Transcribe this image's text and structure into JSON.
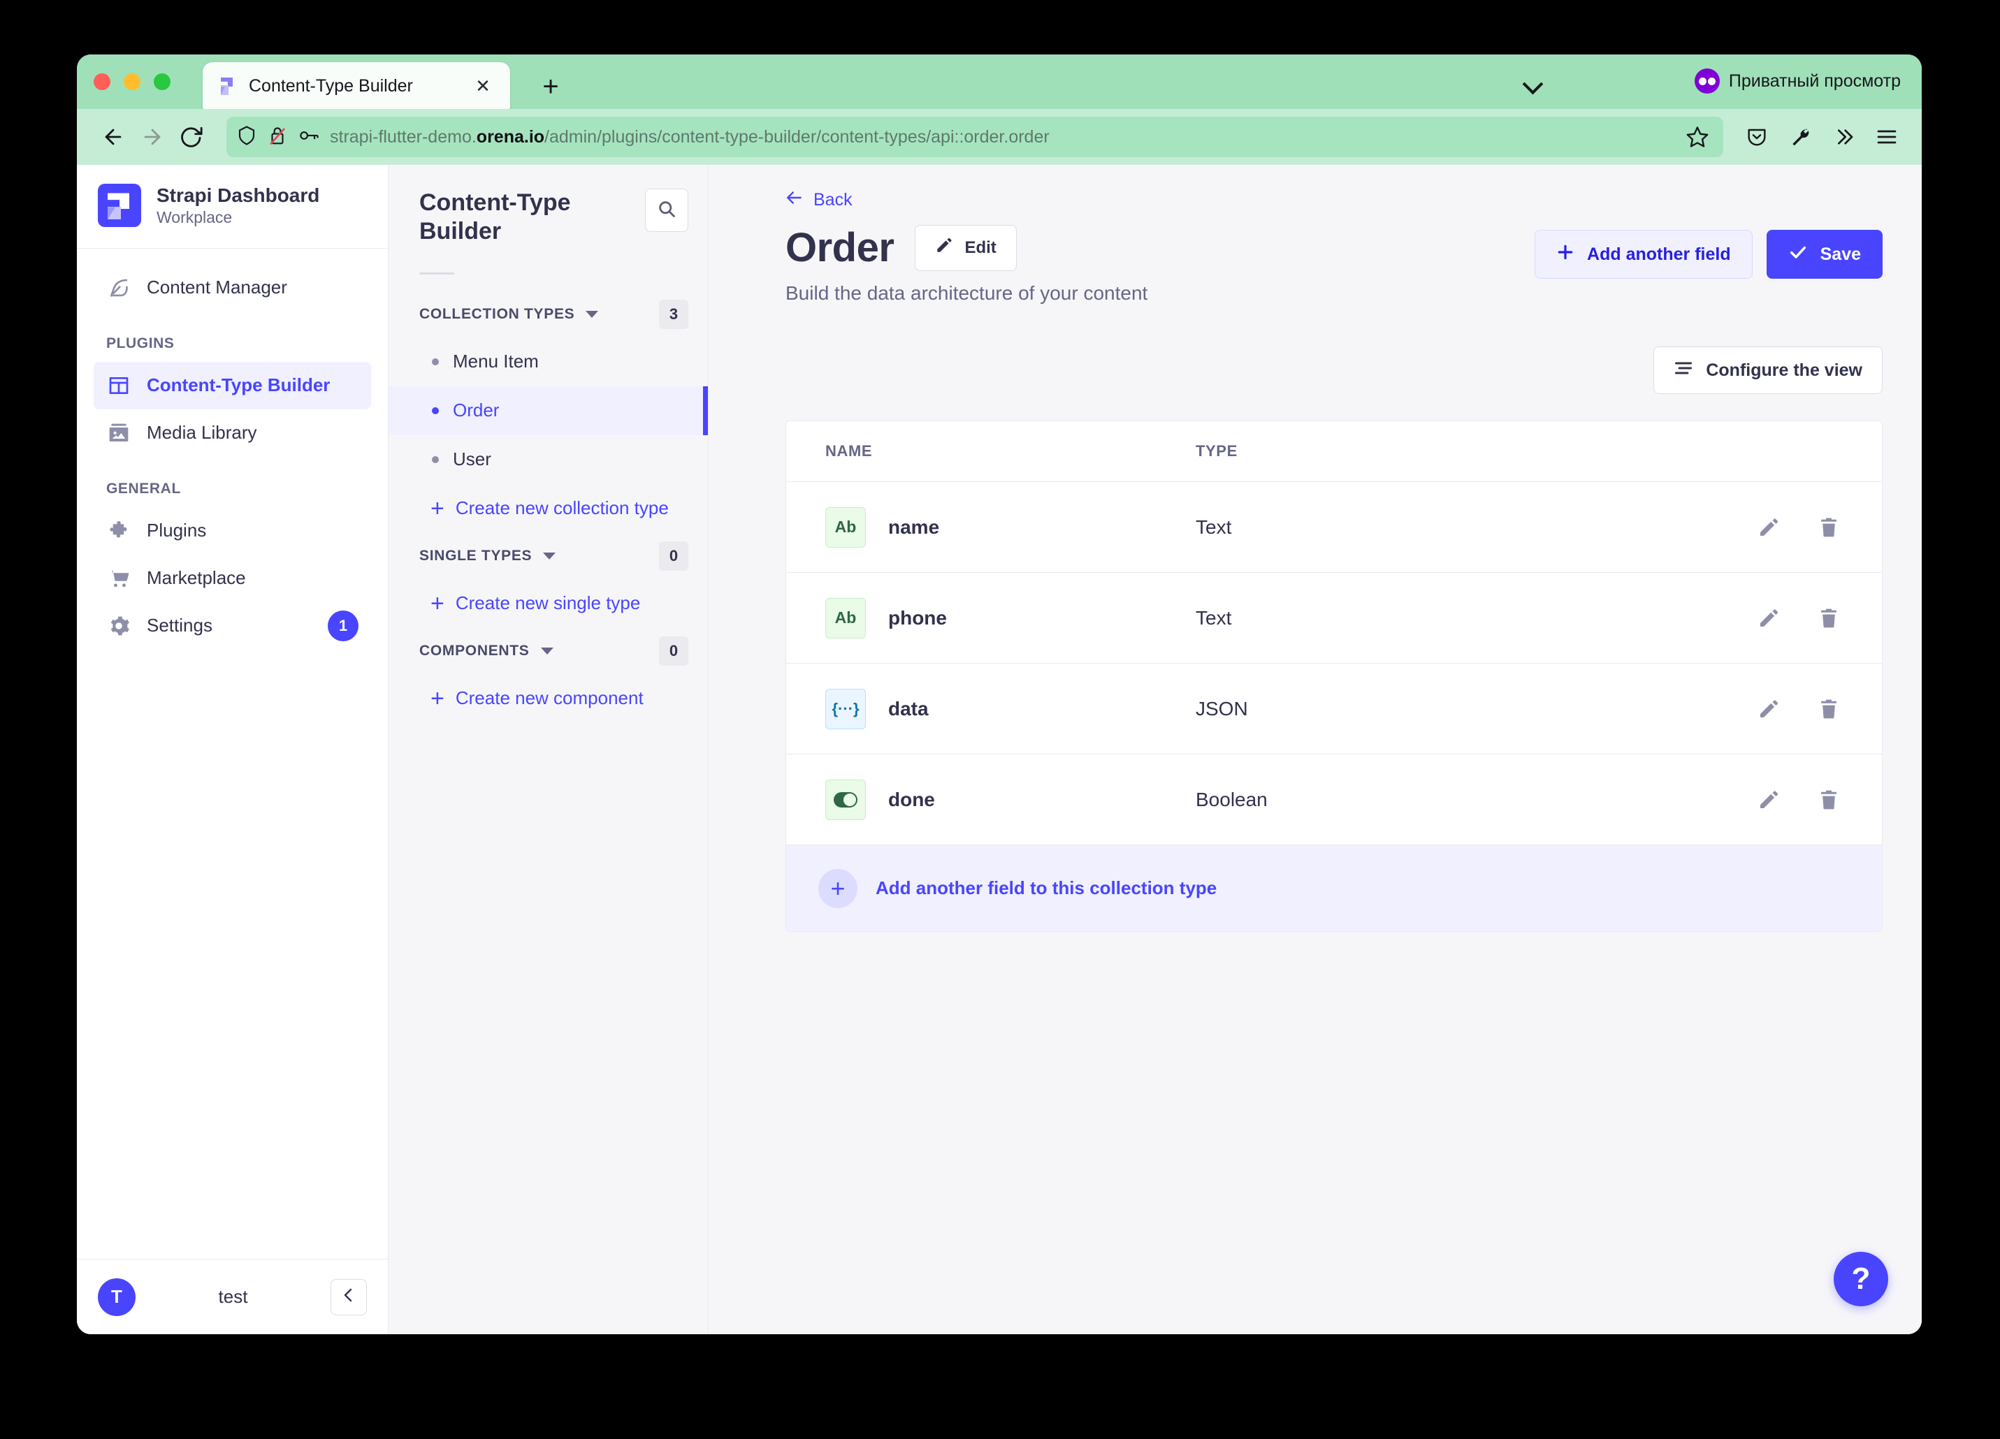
{
  "browser": {
    "tab": {
      "title": "Content-Type Builder",
      "favicon": "strapi-logo-icon",
      "close": "✕"
    },
    "newtab_label": "+",
    "private_label": "Приватный просмотр",
    "url": {
      "prefix": "strapi-flutter-demo.",
      "host": "orena.io",
      "path": "/admin/plugins/content-type-builder/content-types/api::order.order"
    },
    "colors": {
      "tabstrip": "#9fe0b9",
      "navbar": "#c5edd5",
      "urlbar": "#a6e4c0"
    }
  },
  "sidebar": {
    "brand": {
      "name": "Strapi Dashboard",
      "subtitle": "Workplace"
    },
    "primary": [
      {
        "label": "Content Manager",
        "icon": "feather-icon",
        "active": false
      }
    ],
    "groups": [
      {
        "title": "PLUGINS",
        "items": [
          {
            "label": "Content-Type Builder",
            "icon": "layout-icon",
            "active": true
          },
          {
            "label": "Media Library",
            "icon": "image-icon",
            "active": false
          }
        ]
      },
      {
        "title": "GENERAL",
        "items": [
          {
            "label": "Plugins",
            "icon": "puzzle-icon",
            "active": false
          },
          {
            "label": "Marketplace",
            "icon": "cart-icon",
            "active": false
          },
          {
            "label": "Settings",
            "icon": "gear-icon",
            "active": false,
            "badge": "1"
          }
        ]
      }
    ],
    "footer": {
      "avatar_initial": "T",
      "user": "test",
      "collapse_icon": "chevron-left-icon"
    }
  },
  "ctb": {
    "title": "Content-Type Builder",
    "search_icon": "search-icon",
    "sections": [
      {
        "label": "COLLECTION TYPES",
        "count": "3",
        "items": [
          {
            "label": "Menu Item",
            "active": false
          },
          {
            "label": "Order",
            "active": true
          },
          {
            "label": "User",
            "active": false
          }
        ],
        "create_label": "Create new collection type"
      },
      {
        "label": "SINGLE TYPES",
        "count": "0",
        "items": [],
        "create_label": "Create new single type"
      },
      {
        "label": "COMPONENTS",
        "count": "0",
        "items": [],
        "create_label": "Create new component"
      }
    ]
  },
  "main": {
    "back_label": "Back",
    "title": "Order",
    "edit_label": "Edit",
    "subtitle": "Build the data architecture of your content",
    "add_field_label": "Add another field",
    "save_label": "Save",
    "configure_label": "Configure the view",
    "table": {
      "headers": {
        "name": "NAME",
        "type": "TYPE"
      },
      "rows": [
        {
          "icon": "text-field-icon",
          "icon_label": "Ab",
          "icon_kind": "text",
          "name": "name",
          "type": "Text"
        },
        {
          "icon": "text-field-icon",
          "icon_label": "Ab",
          "icon_kind": "text",
          "name": "phone",
          "type": "Text"
        },
        {
          "icon": "json-field-icon",
          "icon_label": "{···}",
          "icon_kind": "json",
          "name": "data",
          "type": "JSON"
        },
        {
          "icon": "boolean-field-icon",
          "icon_label": "",
          "icon_kind": "bool",
          "name": "done",
          "type": "Boolean"
        }
      ],
      "footer_label": "Add another field to this collection type"
    },
    "help_label": "?"
  },
  "colors": {
    "accent": "#4945ff",
    "accent_soft": "#f0f0ff",
    "text": "#32324d",
    "muted": "#666687"
  }
}
